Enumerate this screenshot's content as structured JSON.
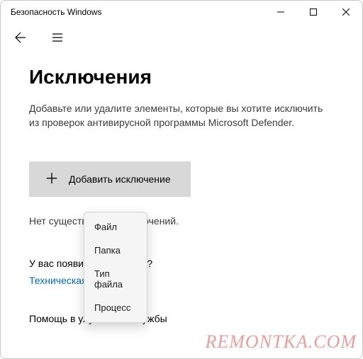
{
  "window": {
    "title": "Безопасность Windows"
  },
  "page": {
    "heading": "Исключения",
    "description": "Добавьте или удалите элементы, которые вы хотите исключить из проверок антивирусной программы Microsoft Defender.",
    "add_button_label": "Добавить исключение",
    "status_text": "Нет существующих исключений.",
    "question": "У вас появились вопросы?",
    "support_link": "Техническая поддержка",
    "help_title": "Помощь в улучшении службы"
  },
  "menu": {
    "items": [
      {
        "label": "Файл"
      },
      {
        "label": "Папка"
      },
      {
        "label": "Тип файла"
      },
      {
        "label": "Процесс"
      }
    ]
  },
  "watermark": "REMONTKA.COM"
}
